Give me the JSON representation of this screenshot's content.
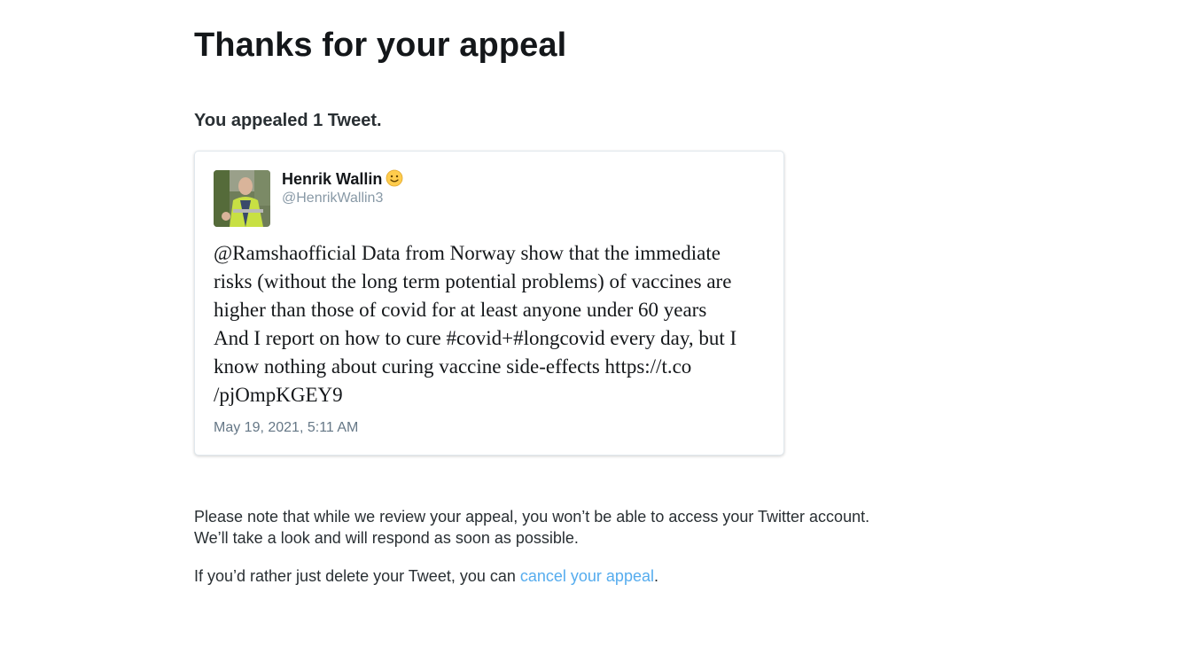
{
  "page": {
    "title": "Thanks for your appeal",
    "subtitle": "You appealed 1 Tweet."
  },
  "tweet": {
    "author_name": "Henrik Wallin",
    "author_handle": "@HenrikWallin3",
    "author_emoji_icon": "slightly-smiling-face-icon",
    "text_lines": [
      "@Ramshaofficial Data from Norway show that the immediate",
      "risks (without the long term potential problems) of vaccines are",
      "higher than those of covid for at least anyone under 60 years",
      "And I report on how to cure #covid+#longcovid every day, but I",
      "know nothing about curing vaccine side-effects https://t.co",
      "/pjOmpKGEY9"
    ],
    "date": "May 19, 2021, 5:11 AM"
  },
  "notice": {
    "line1": "Please note that while we review your appeal, you won’t be able to access your Twitter account.",
    "line2": "We’ll take a look and will respond as soon as possible."
  },
  "cancel": {
    "prefix": "If you’d rather just delete your Tweet, you can ",
    "link_label": "cancel your appeal",
    "suffix": "."
  },
  "colors": {
    "link": "#55acee",
    "handle": "#8899a6",
    "card_border": "#e1e8ed"
  }
}
